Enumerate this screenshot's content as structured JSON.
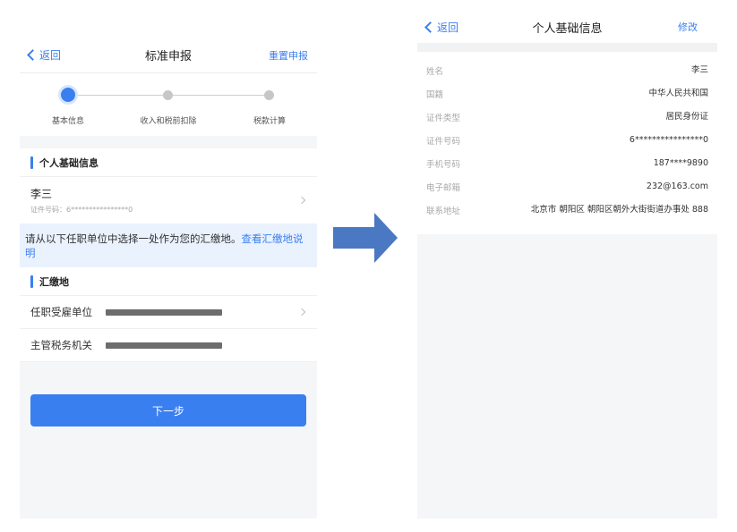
{
  "left": {
    "nav": {
      "back_label": "返回",
      "title": "标准申报",
      "action_label": "重置申报"
    },
    "steps": [
      {
        "label": "基本信息",
        "active": true
      },
      {
        "label": "收入和税前扣除",
        "active": false
      },
      {
        "label": "税款计算",
        "active": false
      }
    ],
    "personal_section_title": "个人基础信息",
    "person": {
      "name": "李三",
      "id_text": "证件号码：6****************0"
    },
    "notice": {
      "text": "请从以下任职单位中选择一处作为您的汇缴地。",
      "link": "查看汇缴地说明"
    },
    "payment_section_title": "汇缴地",
    "fields": [
      {
        "label": "任职受雇单位"
      },
      {
        "label": "主管税务机关"
      }
    ],
    "next_label": "下一步"
  },
  "right": {
    "nav": {
      "back_label": "返回",
      "title": "个人基础信息",
      "action_label": "修改"
    },
    "rows": [
      {
        "label": "姓名",
        "value": "李三"
      },
      {
        "label": "国籍",
        "value": "中华人民共和国"
      },
      {
        "label": "证件类型",
        "value": "居民身份证"
      },
      {
        "label": "证件号码",
        "value": "6****************0"
      },
      {
        "label": "手机号码",
        "value": "187****9890"
      },
      {
        "label": "电子邮箱",
        "value": "232@163.com"
      },
      {
        "label": "联系地址",
        "value": "北京市 朝阳区 朝阳区朝外大街街道办事处 888"
      }
    ]
  },
  "colors": {
    "accent": "#3a7ff0",
    "arrow": "#4a78c2",
    "notice_bg": "#eaf2fe"
  }
}
